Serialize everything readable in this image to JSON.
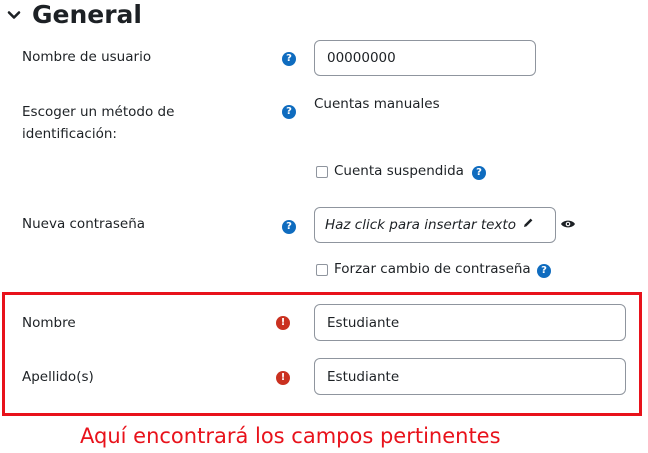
{
  "section": {
    "title": "General",
    "collapse_icon": "chevron-down-icon"
  },
  "fields": {
    "username": {
      "label": "Nombre de usuario",
      "value": "00000000",
      "help_icon": "question-circle-icon"
    },
    "auth": {
      "label_line1": "Escoger un método de",
      "label_line2": "identificación:",
      "value": "Cuentas manuales",
      "help_icon": "question-circle-icon"
    },
    "suspended": {
      "label": "Cuenta suspendida",
      "checked": false,
      "help_icon": "question-circle-icon"
    },
    "new_password": {
      "label": "Nueva contraseña",
      "placeholder": "Haz click para insertar texto",
      "help_icon": "question-circle-icon",
      "edit_icon": "pencil-icon",
      "reveal_icon": "eye-icon"
    },
    "force_change": {
      "label": "Forzar cambio de contraseña",
      "checked": false,
      "help_icon": "question-circle-icon"
    },
    "firstname": {
      "label": "Nombre",
      "value": "Estudiante",
      "required_icon": "exclamation-circle-icon"
    },
    "lastname": {
      "label": "Apellido(s)",
      "value": "Estudiante",
      "required_icon": "exclamation-circle-icon"
    }
  },
  "annotation": {
    "caption": "Aquí encontrará los campos pertinentes",
    "color": "#e8121b"
  },
  "colors": {
    "help": "#0f6cbf",
    "required": "#ca3120",
    "border": "#8f959e"
  }
}
